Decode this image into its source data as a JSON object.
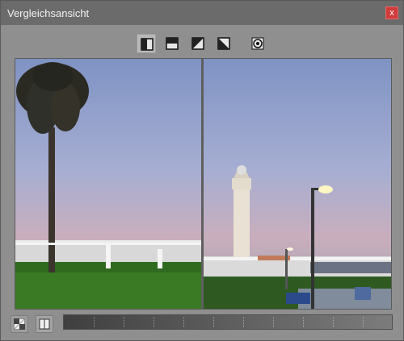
{
  "window": {
    "title": "Vergleichsansicht",
    "close_label": "x"
  },
  "toolbar": {
    "buttons": [
      {
        "name": "split-vertical",
        "icon": "split-vertical-icon",
        "active": true
      },
      {
        "name": "split-horizontal",
        "icon": "split-horizontal-icon",
        "active": false
      },
      {
        "name": "split-diagonal-left",
        "icon": "split-diagonal-left-icon",
        "active": false
      },
      {
        "name": "split-diagonal-right",
        "icon": "split-diagonal-right-icon",
        "active": false
      },
      {
        "name": "sync-view",
        "icon": "sync-view-icon",
        "active": false
      }
    ]
  },
  "comparison": {
    "left_image": "palm-tree-dusk-photo",
    "right_image": "lighthouse-dusk-photo",
    "divider_position": 0.5
  },
  "bottom": {
    "buttons": [
      {
        "name": "checker-toggle",
        "icon": "checkerboard-icon"
      },
      {
        "name": "layout-toggle",
        "icon": "panel-icon"
      }
    ],
    "slider": {
      "ticks": 10
    }
  }
}
